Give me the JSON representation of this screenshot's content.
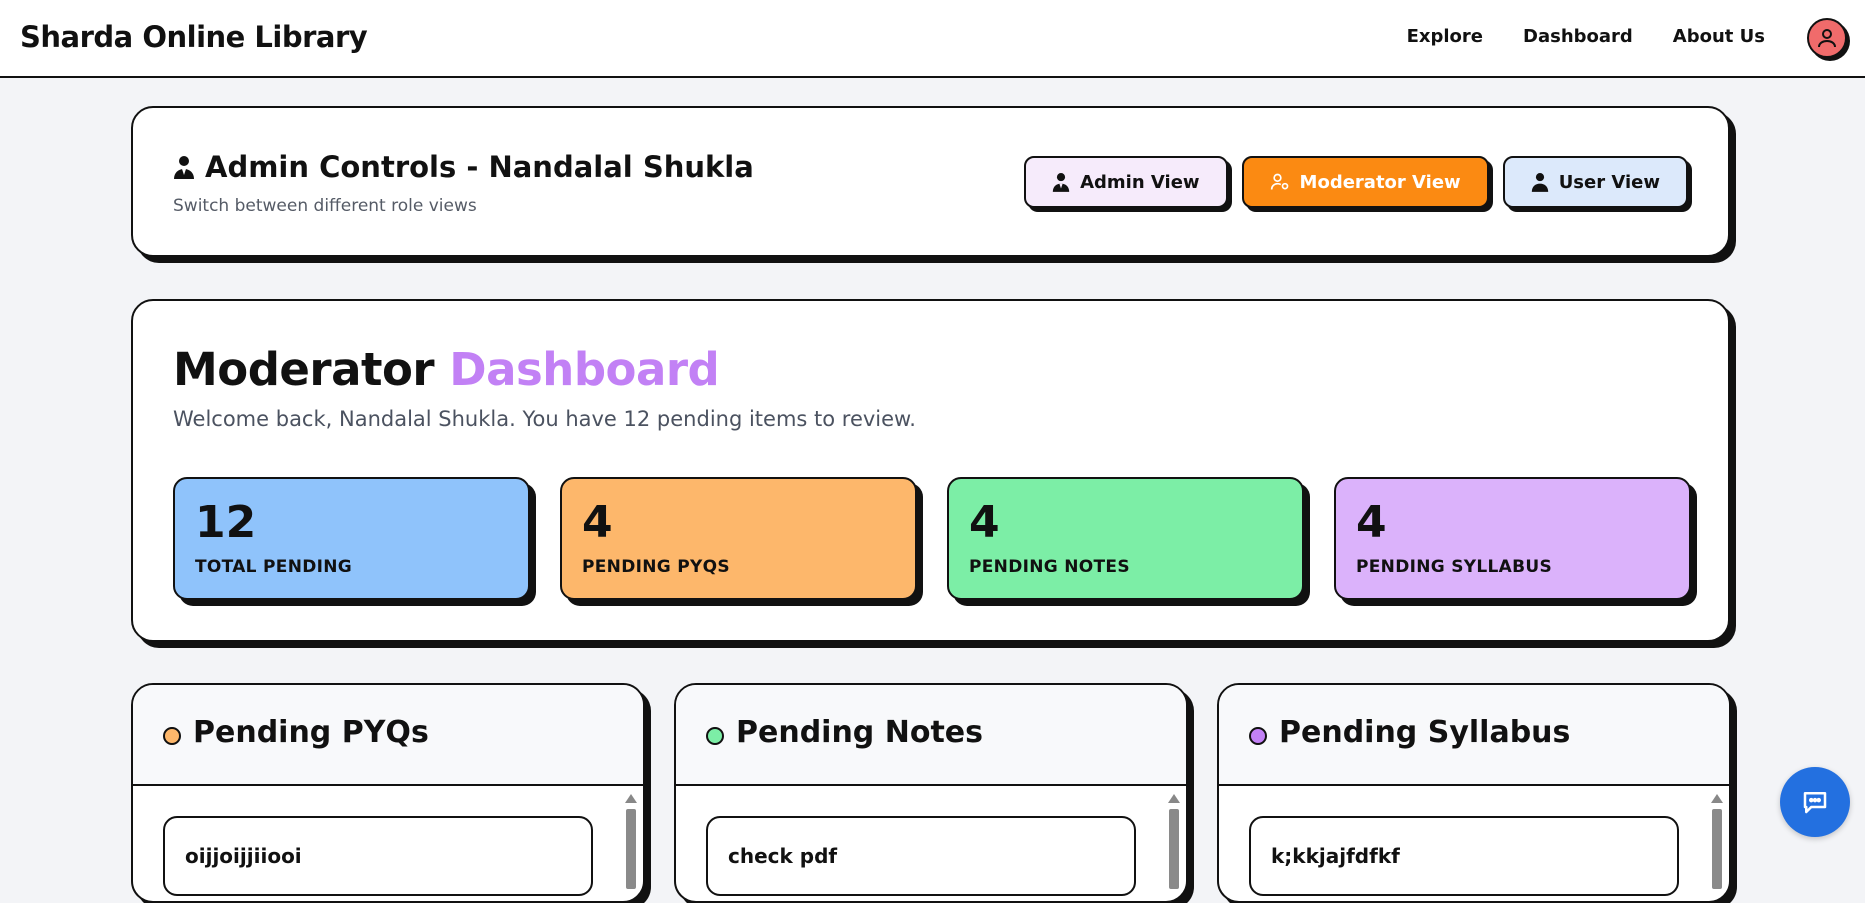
{
  "nav": {
    "brand": "Sharda Online Library",
    "links": [
      "Explore",
      "Dashboard",
      "About Us"
    ]
  },
  "admin": {
    "title": "Admin Controls - Nandalal Shukla",
    "subtitle": "Switch between different role views",
    "buttons": {
      "admin": "Admin View",
      "moderator": "Moderator View",
      "user": "User View"
    }
  },
  "dashboard": {
    "title_main": "Moderator",
    "title_accent": "Dashboard",
    "subtitle": "Welcome back, Nandalal Shukla. You have 12 pending items to review.",
    "stats": [
      {
        "value": "12",
        "label": "TOTAL PENDING",
        "color": "#8fc3fb"
      },
      {
        "value": "4",
        "label": "PENDING PYQS",
        "color": "#fdb76b"
      },
      {
        "value": "4",
        "label": "PENDING NOTES",
        "color": "#7ceea6"
      },
      {
        "value": "4",
        "label": "PENDING SYLLABUS",
        "color": "#dbb2fb"
      }
    ]
  },
  "lists": [
    {
      "title": "Pending PYQs",
      "dot_color": "#fdb76b",
      "first_item": "oijjoijjiiooi"
    },
    {
      "title": "Pending Notes",
      "dot_color": "#7ceea6",
      "first_item": "check pdf"
    },
    {
      "title": "Pending Syllabus",
      "dot_color": "#c281f5",
      "first_item": "k;kkjajfdfkf"
    }
  ],
  "colors": {
    "moderator_button": "#fb8a12",
    "accent_purple": "#c281f5",
    "chat_button": "#2370e0"
  },
  "icons": {
    "admin": "admin-user-icon",
    "moderator": "moderator-user-icon",
    "user": "user-icon",
    "chat": "chat-icon",
    "avatar": "user-avatar-icon"
  }
}
